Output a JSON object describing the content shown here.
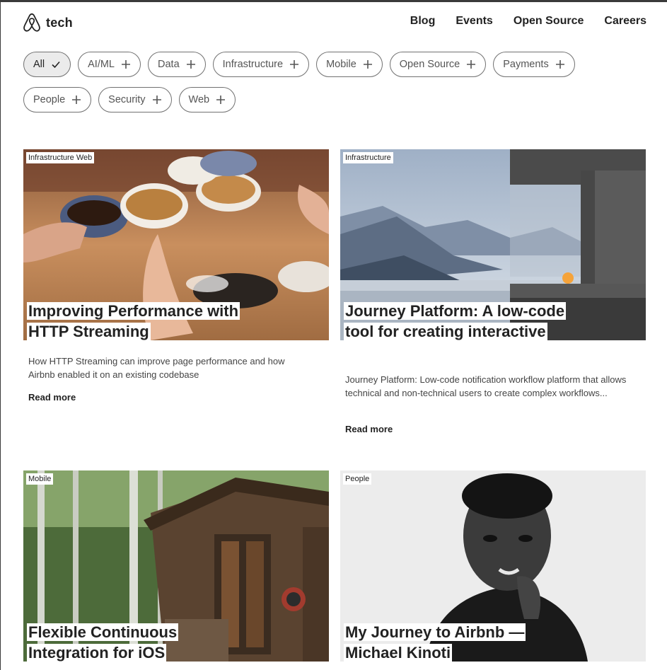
{
  "header": {
    "logo_text": "tech",
    "nav": [
      "Blog",
      "Events",
      "Open Source",
      "Careers"
    ]
  },
  "filters": [
    {
      "label": "All",
      "active": true
    },
    {
      "label": "AI/ML",
      "active": false
    },
    {
      "label": "Data",
      "active": false
    },
    {
      "label": "Infrastructure",
      "active": false
    },
    {
      "label": "Mobile",
      "active": false
    },
    {
      "label": "Open Source",
      "active": false
    },
    {
      "label": "Payments",
      "active": false
    },
    {
      "label": "People",
      "active": false
    },
    {
      "label": "Security",
      "active": false
    },
    {
      "label": "Web",
      "active": false
    }
  ],
  "posts": [
    {
      "tag": "Infrastructure Web",
      "title": "Improving Performance with HTTP Streaming",
      "description": "How HTTP Streaming can improve page performance and how Airbnb enabled it on an existing codebase",
      "read_more": "Read more",
      "image": "coffee-cups-photo"
    },
    {
      "tag": "Infrastructure",
      "title": "Journey Platform: A low-code tool for creating interactive user workflows",
      "description": "Journey Platform: Low-code notification workflow platform that allows technical and non-technical users to create complex workflows...",
      "read_more": "Read more",
      "image": "lake-house-photo"
    },
    {
      "tag": "Mobile",
      "title": "Flexible Continuous Integration for iOS",
      "image": "treehouse-forest-photo"
    },
    {
      "tag": "People",
      "title": "My Journey to Airbnb — Michael Kinoti",
      "image": "portrait-photo"
    }
  ]
}
